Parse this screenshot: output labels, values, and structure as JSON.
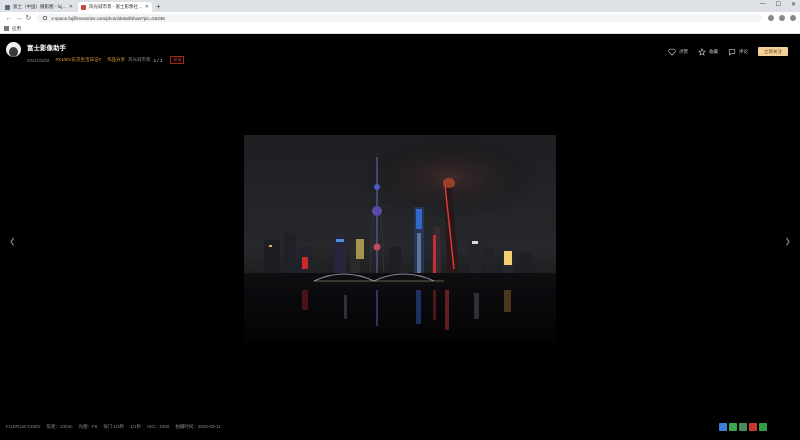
{
  "browser": {
    "tabs": [
      {
        "label": "富士（中国）摄影圈 - fujifilm",
        "active": false
      },
      {
        "label": "风光城市景 - 富士影像社区 - 富",
        "active": true
      }
    ],
    "new_tab": "+",
    "window_controls": [
      "—",
      "☐",
      "✕"
    ],
    "url": "x-space.fujifilmxseries.com/photo/detail/show?pic=56236",
    "bookmarks_label": "应用"
  },
  "author": {
    "name": "富士影像助手",
    "date": "2021/01/02",
    "tag": "#X100V东京生活日记#",
    "album": "作品分享",
    "album_sub": "风光城市景",
    "count": "1 / 1",
    "report": "举报"
  },
  "actions": {
    "like": "点赞",
    "collect": "收藏",
    "comment": "评论",
    "follow": "立即关注"
  },
  "nav": {
    "prev": "‹",
    "next": "›"
  },
  "exif": [
    "FUJIFILM X100V",
    "焦距：23mm",
    "光圈：F8",
    "快门:1/4秒",
    "1/1秒",
    "ISO：1600",
    "拍摄时间：2020-03-11"
  ],
  "share_colors": [
    "#3b7fd6",
    "#3aa757",
    "#4a8a5c",
    "#c9352b",
    "#2f9e44"
  ]
}
